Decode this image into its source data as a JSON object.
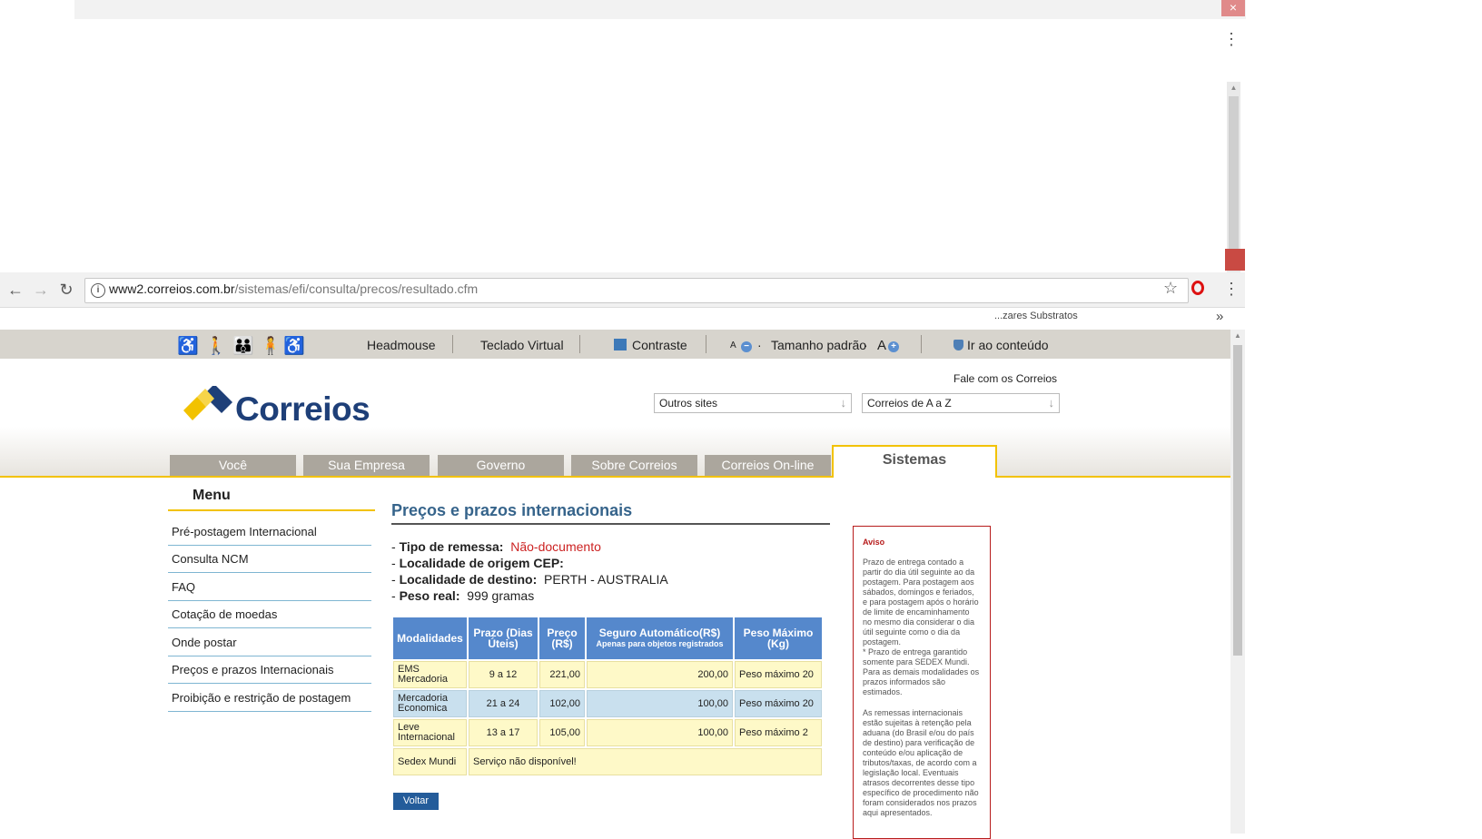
{
  "browser": {
    "url_host": "www2.correios.com.br",
    "url_path": "/sistemas/efi/consulta/precos/resultado.cfm",
    "bookmark_partial": "...zares Substratos",
    "bookmarks_more": "»",
    "close_glyph": "×"
  },
  "accessibility": {
    "headmouse": "Headmouse",
    "teclado": "Teclado Virtual",
    "contraste": "Contraste",
    "a_small": "A",
    "tamanho": "Tamanho padrão",
    "a_large": "A",
    "ir_conteudo": "Ir ao conteúdo"
  },
  "header": {
    "logo_text": "Correios",
    "fale": "Fale com os Correios",
    "select_outros": "Outros sites",
    "select_az": "Correios de A a Z"
  },
  "tabs": [
    "Você",
    "Sua Empresa",
    "Governo",
    "Sobre Correios",
    "Correios On-line"
  ],
  "active_tab": "Sistemas",
  "menu": {
    "title": "Menu",
    "items": [
      "Pré-postagem Internacional",
      "Consulta NCM",
      "FAQ",
      "Cotação de moedas",
      "Onde postar",
      "Preços e prazos Internacionais",
      "Proibição e restrição de postagem"
    ]
  },
  "main": {
    "title": "Preços e prazos internacionais",
    "tipo_label": "Tipo de remessa:",
    "tipo_value": "Não-documento",
    "origem_label": "Localidade de origem CEP:",
    "destino_label": "Localidade de destino:",
    "destino_value": "PERTH - AUSTRALIA",
    "peso_label": "Peso real:",
    "peso_value": "999 gramas",
    "table": {
      "headers": {
        "modalidades": "Modalidades",
        "prazo": "Prazo (Dias Úteis)",
        "preco": "Preço (R$)",
        "seguro": "Seguro Automático(R$)",
        "seguro_note": "Apenas para objetos registrados",
        "peso": "Peso Máximo (Kg)"
      },
      "rows": [
        {
          "modalidade": "EMS Mercadoria",
          "prazo": "9 a 12",
          "preco": "221,00",
          "seguro": "200,00",
          "peso": "Peso máximo 20"
        },
        {
          "modalidade": "Mercadoria Economica",
          "prazo": "21 a 24",
          "preco": "102,00",
          "seguro": "100,00",
          "peso": "Peso máximo 20"
        },
        {
          "modalidade": "Leve Internacional",
          "prazo": "13 a 17",
          "preco": "105,00",
          "seguro": "100,00",
          "peso": "Peso máximo 2"
        }
      ],
      "sedex": {
        "modalidade": "Sedex Mundi",
        "msg": "Serviço não disponível!"
      }
    },
    "voltar": "Voltar"
  },
  "aviso": {
    "title": "Aviso",
    "p1": "Prazo de entrega contado a partir do dia útil seguinte ao da postagem. Para postagem aos sábados, domingos e feriados, e para postagem após o horário de limite de encaminhamento no mesmo dia considerar o dia útil seguinte como o dia da postagem.",
    "p2": "* Prazo de entrega garantido somente para SEDEX Mundi. Para as demais modalidades os prazos informados são estimados.",
    "p3": "As remessas internacionais estão sujeitas à retenção pela aduana (do Brasil e/ou do país de destino) para verificação de conteúdo e/ou aplicação de tributos/taxas, de acordo com a legislação local. Eventuais atrasos decorrentes desse tipo específico de procedimento não foram considerados nos prazos aqui apresentados."
  },
  "colors": {
    "brand_blue": "#1e3f78",
    "brand_yellow": "#f2c200",
    "header_blue": "#5588cc",
    "alert_red": "#b71c1c"
  },
  "icons": [
    "info-icon",
    "star-icon",
    "opera-icon",
    "kebab-icon",
    "back-arrow-icon",
    "forward-arrow-icon",
    "reload-icon",
    "contrast-icon",
    "shield-icon",
    "dropdown-arrow-icon",
    "accessibility-figure-icon"
  ]
}
